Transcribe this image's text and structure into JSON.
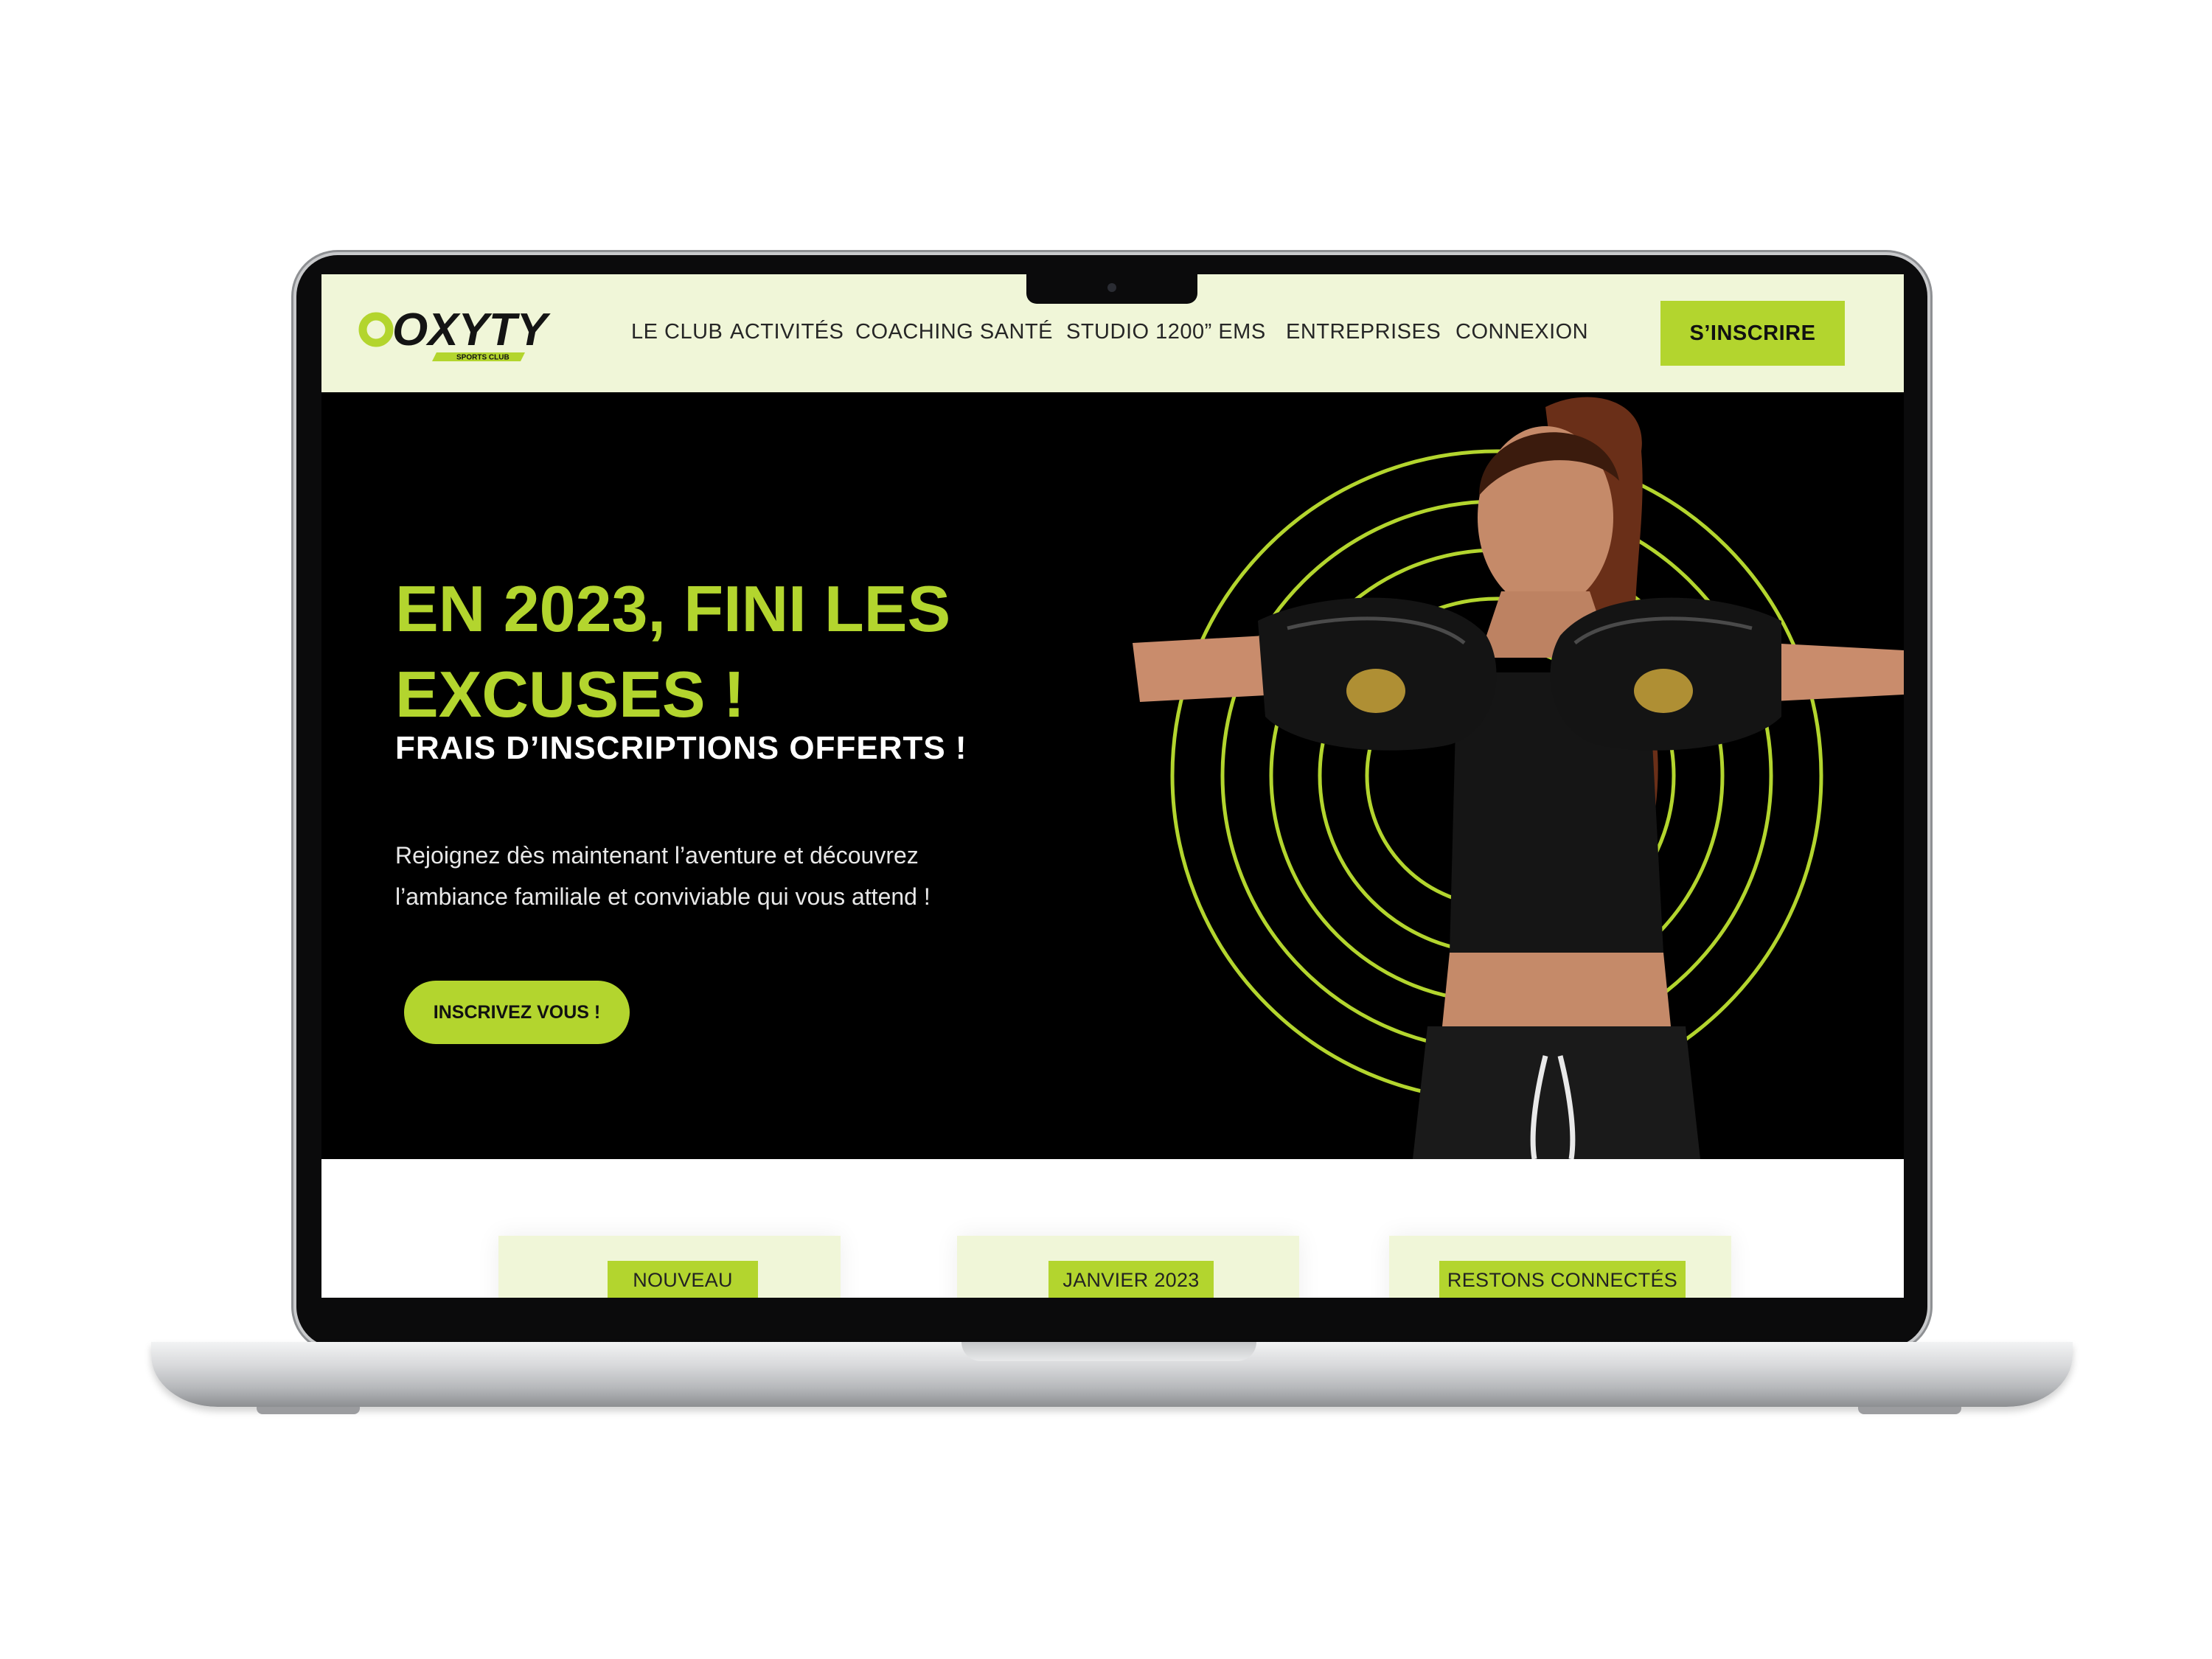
{
  "brand": {
    "logo_text": "OXYTY",
    "logo_tagline": "SPORTS CLUB"
  },
  "nav": {
    "items": [
      "LE CLUB",
      "ACTIVITÉS",
      "COACHING SANTÉ",
      "STUDIO 1200” EMS",
      "ENTREPRISES",
      "CONNEXION"
    ],
    "signup_label": "S’INSCRIRE"
  },
  "hero": {
    "title_line1": "EN 2023, FINI LES",
    "title_line2": "EXCUSES !",
    "subtitle": "FRAIS D’INSCRIPTIONS OFFERTS !",
    "text_line1": "Rejoignez dès maintenant l’aventure et découvrez",
    "text_line2": "l’ambiance familiale et conviviable qui vous attend !",
    "cta_label": "INSCRIVEZ VOUS !"
  },
  "cards": [
    {
      "tag": "NOUVEAU"
    },
    {
      "tag": "JANVIER 2023"
    },
    {
      "tag": "RESTONS CONNECTÉS"
    }
  ],
  "colors": {
    "accent": "#b3d52e",
    "header_bg": "#f0f6d8",
    "hero_bg": "#000000"
  }
}
